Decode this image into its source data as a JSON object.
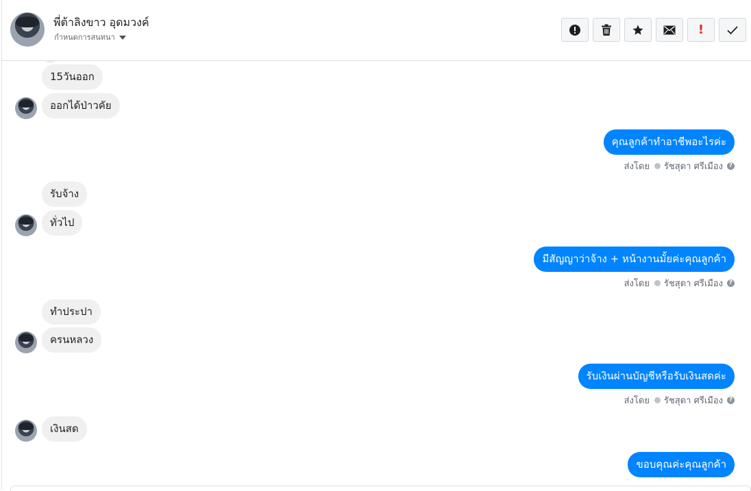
{
  "header": {
    "contact_name": "พี่ต้าลิงขาว อุดมวงค์",
    "contact_sub": "กำหนดการสนทนา"
  },
  "toolbar": [
    {
      "name": "alert-button",
      "icon": "alert-circle-icon"
    },
    {
      "name": "delete-button",
      "icon": "trash-icon"
    },
    {
      "name": "star-button",
      "icon": "star-icon"
    },
    {
      "name": "mark-unread-button",
      "icon": "envelope-icon"
    },
    {
      "name": "important-button",
      "icon": "exclamation-icon",
      "label": "!"
    },
    {
      "name": "done-button",
      "icon": "check-icon"
    }
  ],
  "messages": {
    "in_1": "15วันออก",
    "in_2": "ออกได้ป่าวคัย",
    "out_1": "คุณลูกค้าทำอาชีพอะไรค่ะ",
    "in_3": "รับจ้าง",
    "in_4": "ทั่วไป",
    "out_2": "มีสัญญาว่าจ้าง +  หน้างานมั้ยค่ะคุณลูกค้า",
    "in_5": "ทำประปา",
    "in_6": "ครนหลวง",
    "out_3": "รับเงินผ่านบัญชีหรือรับเงินสดค่ะ",
    "in_7": "เงินสด",
    "out_4": "ขอบคุณค่ะคุณลูกค้า"
  },
  "sent_by": {
    "prefix": "ส่งโดย",
    "agent": "รัชสุดา ศรีเมือง",
    "help": "?"
  },
  "colors": {
    "outgoing_bubble": "#0084ff",
    "incoming_bubble": "#f0f0f0",
    "important": "#e02b20"
  }
}
